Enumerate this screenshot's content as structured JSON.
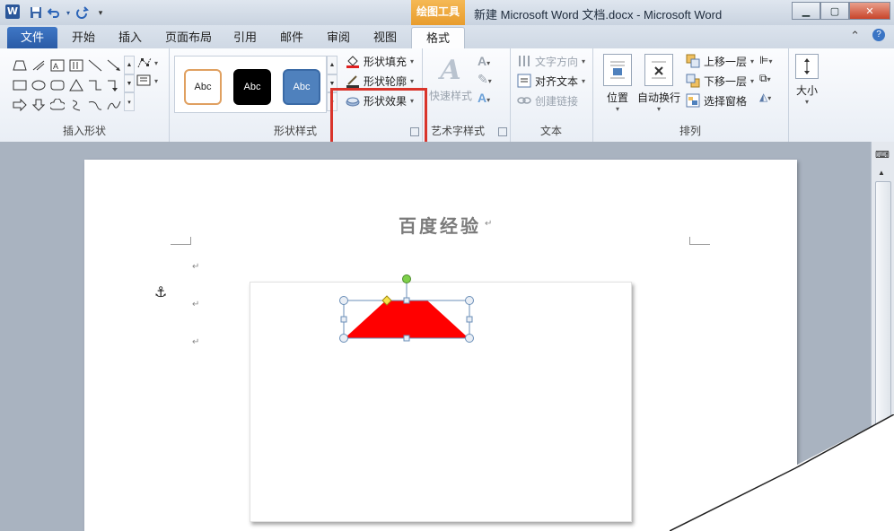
{
  "window": {
    "app_icon": "W",
    "context_tab_group": "绘图工具",
    "title": "新建 Microsoft Word 文档.docx  -  Microsoft Word",
    "buttons": [
      "minimize",
      "maximize",
      "close"
    ]
  },
  "tabs": {
    "file": "文件",
    "items": [
      "开始",
      "插入",
      "页面布局",
      "引用",
      "邮件",
      "审阅",
      "视图"
    ],
    "active": "格式"
  },
  "ribbon": {
    "insert_shapes": {
      "label": "插入形状"
    },
    "shape_styles": {
      "label": "形状样式",
      "presets": [
        {
          "text": "Abc",
          "bg": "#ffffff",
          "border": "#e0a060",
          "color": "#222222"
        },
        {
          "text": "Abc",
          "bg": "#000000",
          "border": "#000000",
          "color": "#ffffff"
        },
        {
          "text": "Abc",
          "bg": "#4f81bd",
          "border": "#3a6aa6",
          "color": "#ffffff"
        }
      ],
      "fill": "形状填充",
      "outline": "形状轮廓",
      "effects": "形状效果"
    },
    "wordart": {
      "label": "艺术字样式",
      "quick_styles": "快速样式"
    },
    "text": {
      "label": "文本",
      "direction": "文字方向",
      "align": "对齐文本",
      "link": "创建链接"
    },
    "arrange": {
      "label": "排列",
      "position": "位置",
      "wrap": "自动换行",
      "bring_forward": "上移一层",
      "send_backward": "下移一层",
      "selection_pane": "选择窗格"
    },
    "size": {
      "label": "大小"
    }
  },
  "document": {
    "title": "百度经验",
    "paragraph_mark": "↵",
    "shape_fill": "#ff0000",
    "highlight_color": "#d9342b"
  }
}
